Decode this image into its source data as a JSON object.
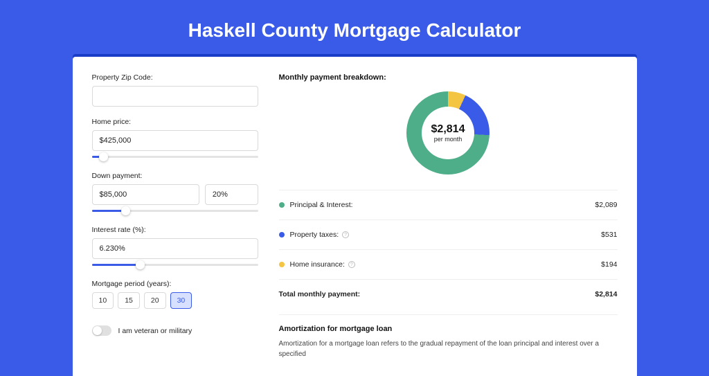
{
  "title": "Haskell County Mortgage Calculator",
  "form": {
    "zip_label": "Property Zip Code:",
    "zip_value": "",
    "home_price_label": "Home price:",
    "home_price_value": "$425,000",
    "home_price_slider_pct": 7,
    "down_label": "Down payment:",
    "down_value": "$85,000",
    "down_pct": "20%",
    "down_slider_pct": 20,
    "rate_label": "Interest rate (%):",
    "rate_value": "6.230%",
    "rate_slider_pct": 29,
    "period_label": "Mortgage period (years):",
    "period_options": [
      "10",
      "15",
      "20",
      "30"
    ],
    "period_selected": "30",
    "veteran_label": "I am veteran or military",
    "veteran_on": false
  },
  "breakdown": {
    "heading": "Monthly payment breakdown:",
    "donut_value": "$2,814",
    "donut_sub": "per month",
    "items": [
      {
        "color": "green",
        "label": "Principal & Interest:",
        "value": "$2,089",
        "help": false
      },
      {
        "color": "blue",
        "label": "Property taxes:",
        "value": "$531",
        "help": true
      },
      {
        "color": "yellow",
        "label": "Home insurance:",
        "value": "$194",
        "help": true
      }
    ],
    "total_label": "Total monthly payment:",
    "total_value": "$2,814"
  },
  "amort": {
    "heading": "Amortization for mortgage loan",
    "text": "Amortization for a mortgage loan refers to the gradual repayment of the loan principal and interest over a specified"
  },
  "chart_data": {
    "type": "pie",
    "title": "Monthly payment breakdown",
    "series": [
      {
        "name": "Principal & Interest",
        "value": 2089,
        "color": "#4fae8a"
      },
      {
        "name": "Property taxes",
        "value": 531,
        "color": "#3a5be8"
      },
      {
        "name": "Home insurance",
        "value": 194,
        "color": "#f4c542"
      }
    ],
    "total": 2814,
    "center_label": "$2,814 per month"
  }
}
